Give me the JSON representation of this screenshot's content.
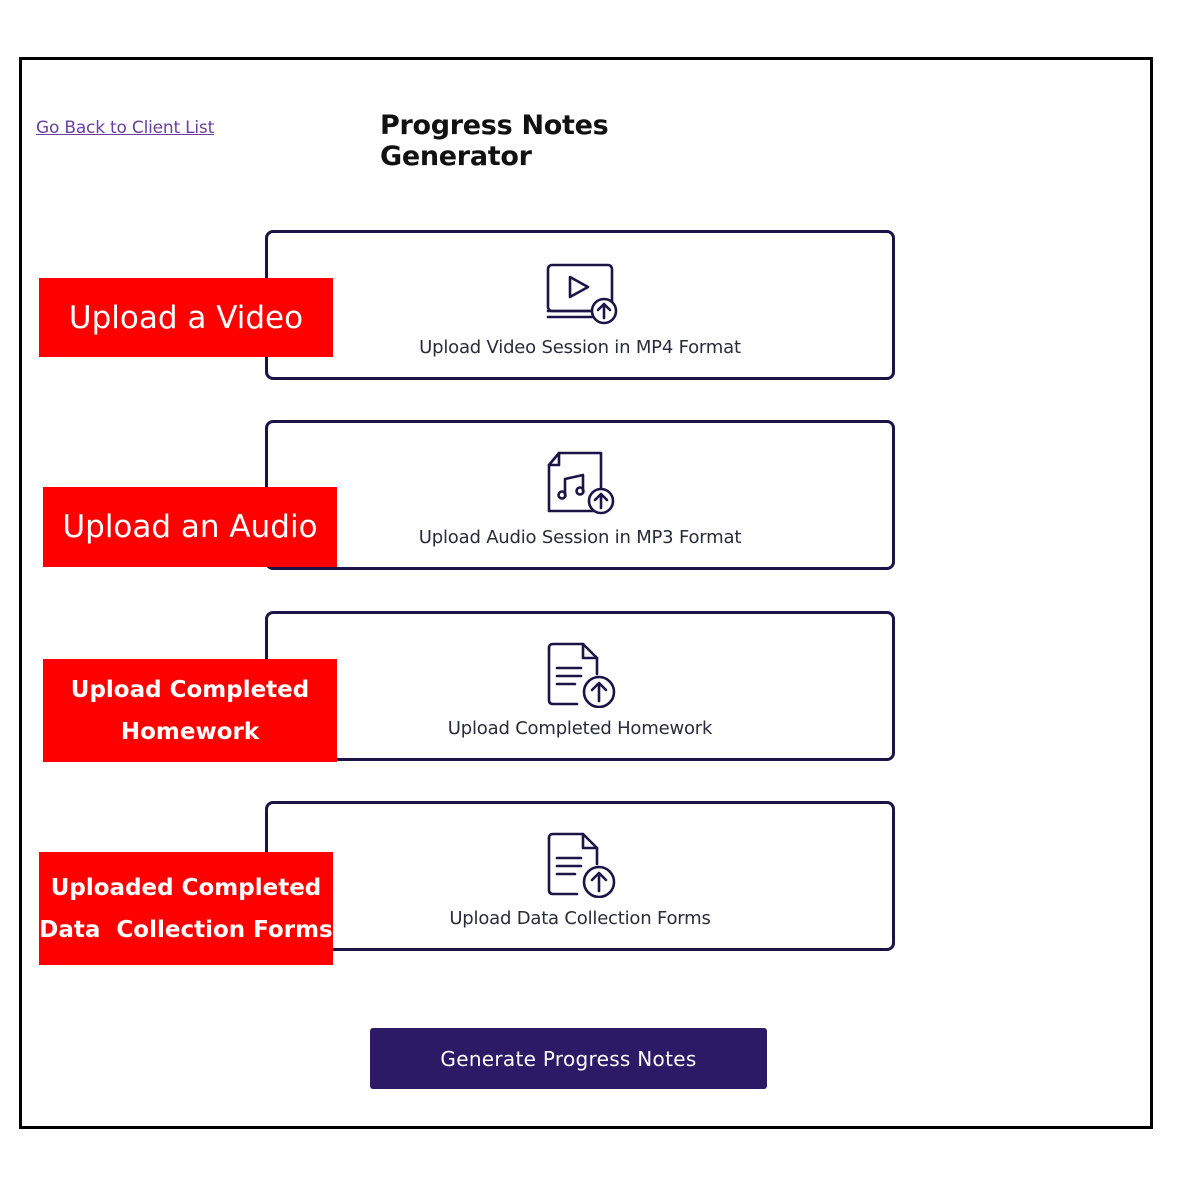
{
  "header": {
    "back_link": "Go Back to Client List",
    "title": "Progress Notes Generator"
  },
  "upload_cards": [
    {
      "label": "Upload Video Session in MP4 Format",
      "icon": "video-upload-icon"
    },
    {
      "label": "Upload Audio Session in MP3 Format",
      "icon": "audio-file-upload-icon"
    },
    {
      "label": "Upload Completed Homework",
      "icon": "document-upload-icon"
    },
    {
      "label": "Upload Data Collection Forms",
      "icon": "document-upload-icon"
    }
  ],
  "callouts": {
    "video": "Upload a Video",
    "audio": "Upload an Audio",
    "homework_line1": "Upload Completed",
    "homework_line2": "Homework",
    "forms_line1": "Uploaded Completed",
    "forms_line2": "Data  Collection Forms"
  },
  "actions": {
    "generate_label": "Generate Progress Notes"
  },
  "colors": {
    "accent": "#2d1a66",
    "card_border": "#1c1447",
    "callout_bg": "#ff0000",
    "link": "#6b3fa0"
  }
}
